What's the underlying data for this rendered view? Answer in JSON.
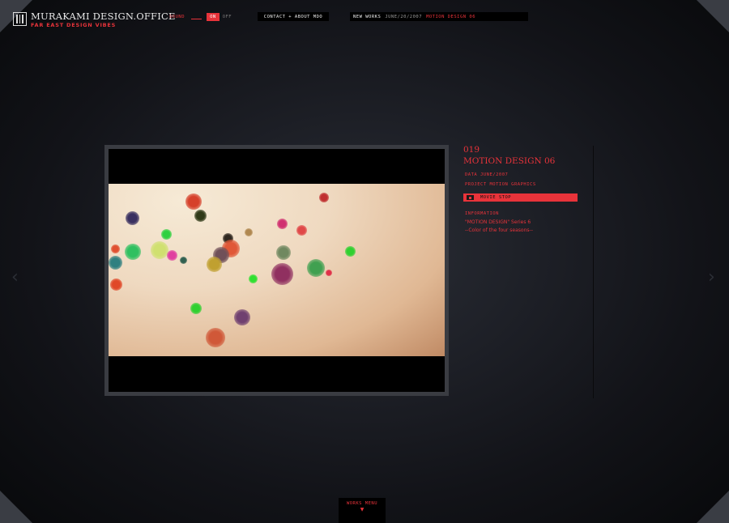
{
  "brand": {
    "title": "MURAKAMI DESIGN.OFFICE",
    "tagline": "FAR EAST DESIGN VIBES"
  },
  "sound": {
    "label": "SOUND",
    "on": "ON",
    "off": "OFF",
    "selected": "ON"
  },
  "nav": {
    "contact": "CONTACT + ABOUT MDO"
  },
  "news": {
    "label": "NEW WORKS",
    "date": "JUNE/20/2007",
    "title": "MOTION DESIGN 06"
  },
  "work": {
    "number": "019",
    "title": "MOTION DESIGN 06",
    "data_line": "DATA  JUNE/2007",
    "project_line": "PROJECT  MOTION GRAPHICS",
    "stop_label": "MOVIE STOP",
    "info_heading": "INFORMATION",
    "desc_line1": "\"MOTION DESIGN\" Series 6",
    "desc_line2": "--Color of the four seasons--"
  },
  "footer": {
    "works_menu": "WORKS MENU",
    "works_arrow": "▼"
  },
  "icons": {
    "prev": "chevron-left-icon",
    "next": "chevron-right-icon",
    "logo": "logo-grid-icon",
    "stop": "stop-icon"
  },
  "colors": {
    "accent": "#e8333a",
    "background": "#1a1c22"
  }
}
